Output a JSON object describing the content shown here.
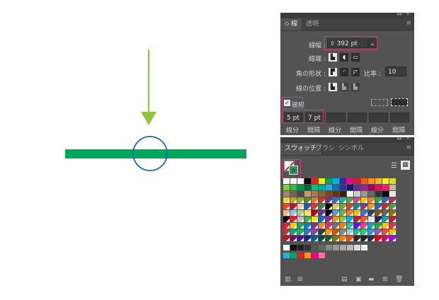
{
  "stroke_panel": {
    "tabs": [
      "線",
      "透明"
    ],
    "weight_label": "線幅",
    "weight_value": "392 pt",
    "cap_label": "線端",
    "corner_label": "角の形状",
    "limit_label": "比率",
    "limit_value": "10",
    "align_label": "線の位置",
    "dashed_label": "破線",
    "dash_fields": [
      {
        "value": "5 pt",
        "label": "線分"
      },
      {
        "value": "7 pt",
        "label": "間隔"
      },
      {
        "value": "",
        "label": "線分"
      },
      {
        "value": "",
        "label": "間隔"
      },
      {
        "value": "",
        "label": "線分"
      },
      {
        "value": "",
        "label": "間隔"
      }
    ]
  },
  "swatch_panel": {
    "tabs": [
      "スウォッチ",
      "ブラシ",
      "シンボル"
    ]
  },
  "colors": {
    "stroke_green": "#00a65a",
    "arrow_green": "#8dc63f",
    "circle_blue": "#1a6ca8",
    "highlight_pink": "#e2347a",
    "panel_bg": "#535353"
  }
}
